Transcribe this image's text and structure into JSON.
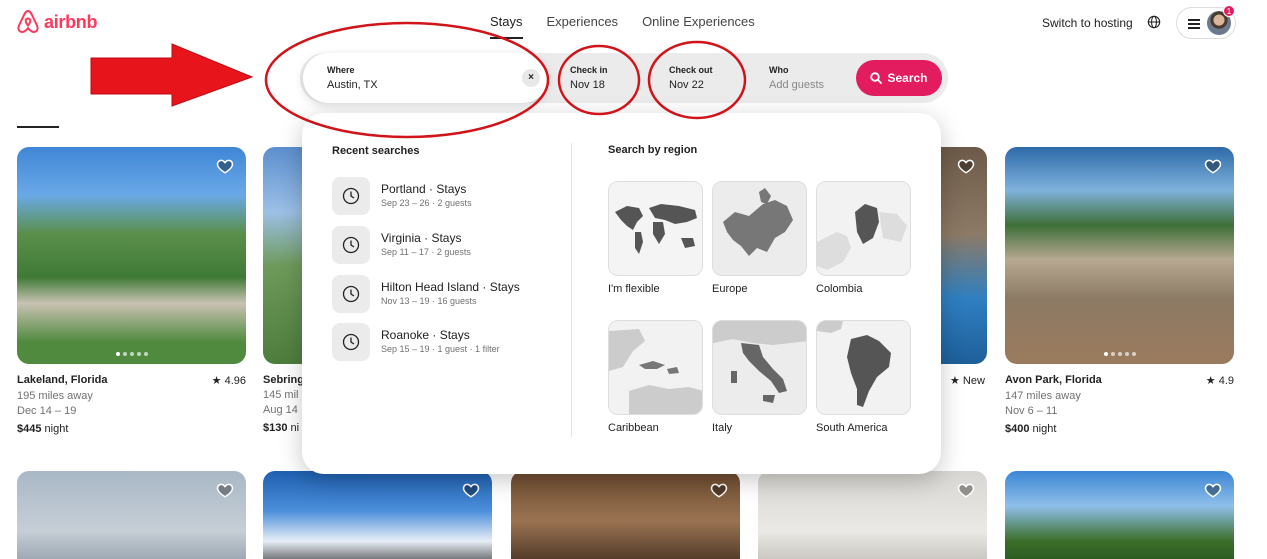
{
  "header": {
    "brand": "airbnb",
    "nav": [
      {
        "label": "Stays",
        "active": true
      },
      {
        "label": "Experiences",
        "active": false
      },
      {
        "label": "Online Experiences",
        "active": false
      }
    ],
    "host_link": "Switch to hosting",
    "notification_count": "1"
  },
  "search": {
    "where_label": "Where",
    "where_value": "Austin, TX",
    "clear_symbol": "×",
    "check_in_label": "Check in",
    "check_in_value": "Nov 18",
    "check_out_label": "Check out",
    "check_out_value": "Nov 22",
    "who_label": "Who",
    "who_placeholder": "Add guests",
    "search_label": "Search"
  },
  "dropdown": {
    "recent_heading": "Recent searches",
    "recent": [
      {
        "title": "Portland · Stays",
        "sub": "Sep 23 – 26 · 2 guests"
      },
      {
        "title": "Virginia · Stays",
        "sub": "Sep 11 – 17 · 2 guests"
      },
      {
        "title": "Hilton Head Island · Stays",
        "sub": "Nov 13 – 19 · 16 guests"
      },
      {
        "title": "Roanoke · Stays",
        "sub": "Sep 15 – 19 · 1 guest · 1 filter"
      }
    ],
    "region_heading": "Search by region",
    "regions": [
      {
        "label": "I'm flexible",
        "icon": "world-map"
      },
      {
        "label": "Europe",
        "icon": "europe-map"
      },
      {
        "label": "Colombia",
        "icon": "colombia-map"
      },
      {
        "label": "Caribbean",
        "icon": "caribbean-map"
      },
      {
        "label": "Italy",
        "icon": "italy-map"
      },
      {
        "label": "South America",
        "icon": "south-america-map"
      }
    ]
  },
  "listings": [
    {
      "title": "Lakeland, Florida",
      "rating": "★ 4.96",
      "distance": "195 miles away",
      "dates": "Dec 14 – 19",
      "price": "$445",
      "price_unit": "night"
    },
    {
      "title": "Sebring",
      "distance": "145 mil",
      "dates": "Aug 14",
      "price": "$130",
      "price_unit": "ni"
    },
    {
      "rating": "★ New"
    },
    {
      "title": "Avon Park, Florida",
      "rating": "★ 4.9",
      "distance": "147 miles away",
      "dates": "Nov 6 – 11",
      "price": "$400",
      "price_unit": "night"
    }
  ],
  "colors": {
    "brand": "#ff385c",
    "search_button": "#e21c5e",
    "annotation": "#e8141c"
  }
}
